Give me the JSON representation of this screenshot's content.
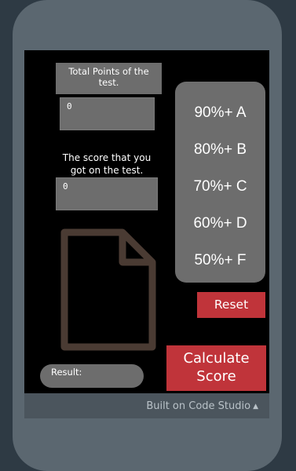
{
  "form": {
    "total_points_label": "Total Points of the test.",
    "total_points_value": "0",
    "score_label": "The score that you got on the test.",
    "score_value": "0",
    "result_label": "Result:"
  },
  "grades": [
    {
      "label": "90%+ A"
    },
    {
      "label": "80%+ B"
    },
    {
      "label": "70%+ C"
    },
    {
      "label": "60%+ D"
    },
    {
      "label": "50%+ F"
    }
  ],
  "buttons": {
    "reset_label": "Reset",
    "calculate_label": "Calculate Score"
  },
  "footer": {
    "text": "Built on Code Studio",
    "caret": "▲"
  },
  "colors": {
    "page_bg": "#2e3a44",
    "phone_frame": "#5b6770",
    "screen_bg": "#000000",
    "box_gray": "#6d6d6d",
    "button_red": "#c0343a",
    "doc_icon_brown": "#4a3b33"
  },
  "icons": {
    "document": "document-icon"
  }
}
